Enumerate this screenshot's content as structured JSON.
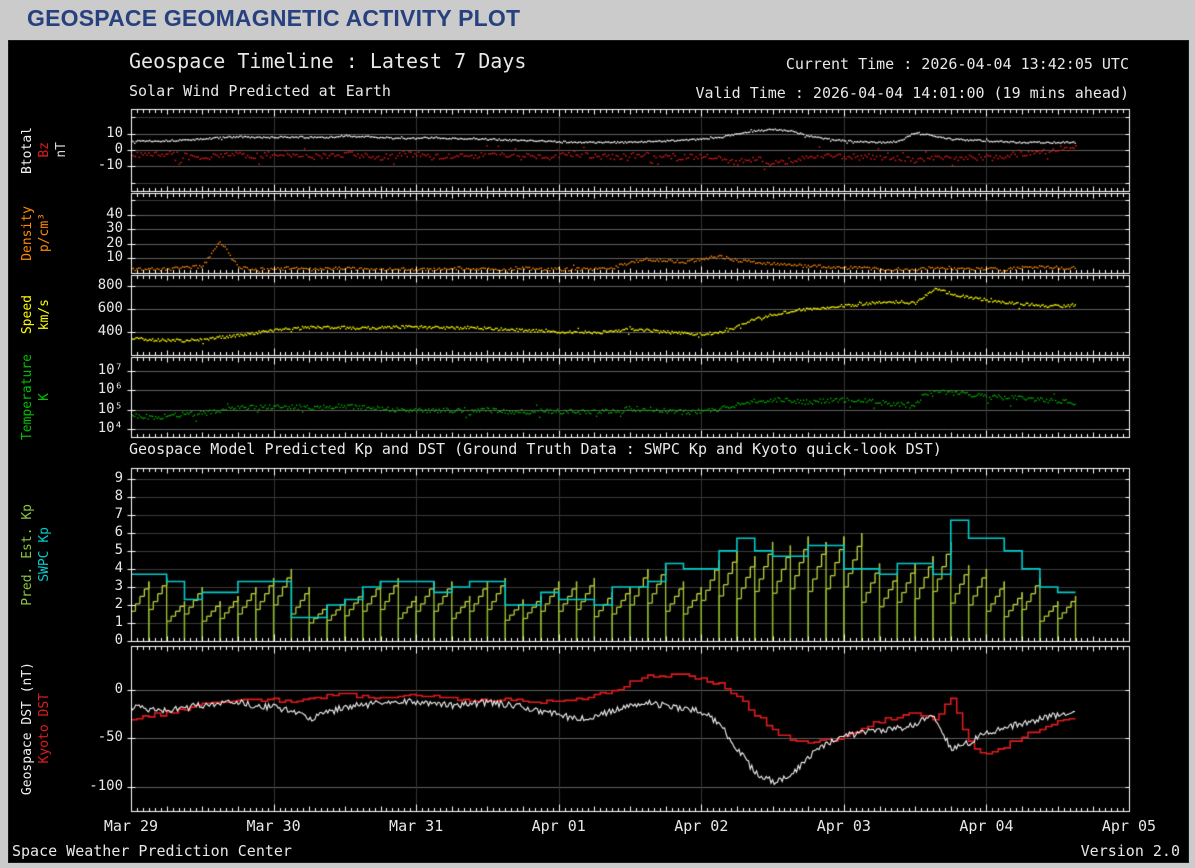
{
  "page_title": "GEOSPACE GEOMAGNETIC ACTIVITY PLOT",
  "header": {
    "title": "Geospace Timeline : Latest 7 Days",
    "subtitle": "Solar Wind Predicted at Earth",
    "current_time": "Current Time : 2026-04-04 13:42:05 UTC",
    "valid_time": "Valid Time : 2026-04-04 14:01:00 (19 mins ahead)"
  },
  "section2": {
    "title": "Geospace Model Predicted Kp and DST (Ground Truth Data : SWPC Kp and Kyoto quick-look DST)"
  },
  "footer": {
    "left": "Space Weather Prediction Center",
    "right": "Version 2.0"
  },
  "colors": {
    "page_bg": "#cbcbcb",
    "title_color": "#26417e",
    "frame_bg": "#000000",
    "text_color": "#e8e8e8",
    "axis": "#ffffff",
    "grid_major": "#5e5e5e",
    "grid_minor": "#3a3a3a",
    "day_line": "#343434",
    "btotal": "#f2f2f2",
    "bz": "#dd1c1c",
    "density": "#ff8c00",
    "speed": "#ffff00",
    "temperature": "#00c000",
    "pred_kp_low": "#6aa821",
    "pred_kp_high": "#e8e84a",
    "pred_kp_label": "#8cc63f",
    "swpc_kp": "#00cccc",
    "geospace_dst": "#f2f2f2",
    "kyoto_dst": "#dd1c1c"
  },
  "x_axis": {
    "labels": [
      "Mar 29",
      "Mar 30",
      "Mar 31",
      "Apr 01",
      "Apr 02",
      "Apr 03",
      "Apr 04",
      "Apr 05"
    ],
    "days_span": 7
  },
  "chart_data": {
    "type": "line",
    "description": "Six stacked time-series panels, Mar 29 00:00 UTC to Apr 05 00:00 UTC; data ends 2026-04-04 ~14:00 UTC",
    "t0_days": 0,
    "dt_days": 0.125,
    "panels": [
      {
        "id": "imf",
        "ylabel_lines": [
          {
            "text": "Btotal",
            "color": "#f2f2f2"
          },
          {
            "text": "Bz",
            "color": "#dd1c1c"
          },
          {
            "text": "nT",
            "color": "#d8d8d8"
          }
        ],
        "scale": "linear",
        "ylim": [
          -25,
          25
        ],
        "yticks": {
          "values": [
            10,
            0,
            -10
          ],
          "labels": [
            "10",
            "0",
            "-10"
          ]
        },
        "grid_major": [
          10,
          0,
          -10
        ],
        "grid_minor": [
          20,
          -20
        ],
        "series": [
          {
            "name": "Btotal",
            "render": "scatter",
            "color": "#f2f2f2",
            "noise": 0.5,
            "spacing": 1.5,
            "size": 1.4,
            "outlier_p": 0.03,
            "values": [
              6,
              6,
              6,
              6.5,
              7,
              8,
              8.5,
              8,
              8,
              8.5,
              8,
              8,
              9,
              8.5,
              8,
              7.5,
              7.5,
              8,
              7.5,
              7,
              7,
              6.5,
              6,
              6,
              5.5,
              5,
              5,
              5,
              5,
              5.5,
              6,
              6.5,
              7,
              8,
              10,
              12,
              13,
              12,
              9,
              7,
              6,
              5.5,
              5,
              5.5,
              11,
              9,
              7,
              6.5,
              6,
              5.5,
              5,
              5,
              5,
              5
            ]
          },
          {
            "name": "Bz",
            "render": "scatter",
            "color": "#dd1c1c",
            "noise": 1.8,
            "spacing": 1.9,
            "size": 1.5,
            "outlier_p": 0.08,
            "values": [
              -2,
              -3,
              -2,
              -3,
              -4,
              -3,
              -2,
              -3,
              -3,
              -2,
              -4,
              -3,
              -2,
              -3,
              -4,
              -3,
              -2,
              -3,
              -4,
              -3,
              -2,
              -2,
              -3,
              -3,
              -3,
              -2,
              -3,
              -4,
              -3,
              -2,
              -3,
              -4,
              -3,
              -5,
              -7,
              -5,
              -8,
              -6,
              -4,
              -3,
              -4,
              -3,
              -4,
              -5,
              -6,
              -4,
              -5,
              -4,
              -4,
              -3,
              -2,
              -1,
              1,
              2
            ]
          }
        ]
      },
      {
        "id": "density",
        "ylabel_lines": [
          {
            "text": "Density",
            "color": "#ff8c00"
          },
          {
            "text": "p/cm³",
            "color": "#ff8c00"
          }
        ],
        "scale": "linear",
        "ylim": [
          0,
          55
        ],
        "yticks": {
          "values": [
            40,
            30,
            20,
            10
          ],
          "labels": [
            "40",
            "30",
            "20",
            "10"
          ]
        },
        "grid_major": [
          40,
          30,
          20,
          10
        ],
        "grid_minor": [
          50
        ],
        "series": [
          {
            "name": "Density",
            "render": "scatter",
            "color": "#ff8c00",
            "noise": 1.1,
            "spacing": 1.7,
            "size": 1.4,
            "outlier_p": 0.02,
            "clamp_min": 0.3,
            "values": [
              3,
              3,
              3,
              4,
              5,
              22,
              4,
              3,
              3,
              4,
              3,
              3,
              4,
              3,
              3,
              3,
              3,
              3,
              4,
              3,
              3,
              3,
              4,
              3,
              3,
              3,
              3,
              4,
              8,
              10,
              9,
              8,
              10,
              12,
              9,
              8,
              7,
              6,
              5,
              5,
              4,
              4,
              3,
              3,
              3,
              4,
              3,
              3,
              3,
              3,
              4,
              5,
              4,
              4
            ]
          }
        ]
      },
      {
        "id": "speed",
        "ylabel_lines": [
          {
            "text": "Speed",
            "color": "#ffff00"
          },
          {
            "text": "km/s",
            "color": "#ffff00"
          }
        ],
        "scale": "linear",
        "ylim": [
          200,
          900
        ],
        "yticks": {
          "values": [
            800,
            600,
            400
          ],
          "labels": [
            "800",
            "600",
            "400"
          ]
        },
        "grid_major": [
          800,
          600,
          400
        ],
        "grid_minor": [],
        "series": [
          {
            "name": "Speed",
            "render": "scatter",
            "color": "#ffff00",
            "noise": 13,
            "spacing": 1.4,
            "size": 1.4,
            "outlier_p": 0.02,
            "values": [
              350,
              340,
              335,
              330,
              340,
              360,
              380,
              400,
              420,
              435,
              445,
              450,
              445,
              440,
              445,
              450,
              450,
              445,
              440,
              445,
              438,
              430,
              422,
              415,
              410,
              405,
              400,
              410,
              430,
              420,
              405,
              392,
              390,
              400,
              450,
              520,
              560,
              590,
              610,
              625,
              635,
              650,
              665,
              670,
              660,
              780,
              745,
              710,
              685,
              665,
              650,
              640,
              632,
              645
            ]
          }
        ]
      },
      {
        "id": "temperature",
        "ylabel_lines": [
          {
            "text": "Temperature",
            "color": "#00c000"
          },
          {
            "text": "K",
            "color": "#00c000"
          }
        ],
        "scale": "log",
        "ylim_log": [
          3.6,
          7.7
        ],
        "yticks": {
          "values": [
            7,
            6,
            5,
            4
          ],
          "labels": [
            "10⁷",
            "10⁶",
            "10⁵",
            "10⁴"
          ]
        },
        "grid_major": [
          7,
          6,
          5,
          4
        ],
        "grid_minor": [],
        "series": [
          {
            "name": "Temperature",
            "render": "scatter",
            "color": "#00c000",
            "noise": 0.13,
            "spacing": 1.5,
            "size": 1.3,
            "outlier_p": 0.04,
            "values": [
              50000,
              45000,
              50000,
              60000,
              70000,
              90000,
              130000,
              150000,
              160000,
              150000,
              140000,
              150000,
              160000,
              140000,
              120000,
              110000,
              100000,
              90000,
              100000,
              110000,
              100000,
              90000,
              85000,
              90000,
              90000,
              80000,
              85000,
              90000,
              120000,
              110000,
              90000,
              80000,
              90000,
              120000,
              200000,
              300000,
              350000,
              300000,
              250000,
              300000,
              350000,
              300000,
              250000,
              200000,
              180000,
              1000000,
              800000,
              600000,
              500000,
              450000,
              400000,
              350000,
              300000,
              250000
            ]
          }
        ]
      },
      {
        "id": "kp",
        "ylabel_lines": [
          {
            "text": "Pred. Est. Kp",
            "color": "#8cc63f"
          },
          {
            "text": "SWPC Kp",
            "color": "#00cccc"
          }
        ],
        "scale": "linear",
        "ylim": [
          0,
          9.6
        ],
        "yticks": {
          "values": [
            9,
            8,
            7,
            6,
            5,
            4,
            3,
            2,
            1,
            0
          ],
          "labels": [
            "9",
            "8",
            "7",
            "6",
            "5",
            "4",
            "3",
            "2",
            "1",
            "0"
          ]
        },
        "grid_major": [],
        "grid_minor": [
          1,
          2,
          3,
          4,
          5,
          6,
          7,
          8,
          9
        ],
        "series": [
          {
            "name": "Pred. Est. Kp",
            "render": "sawtooth",
            "color_low": "#6aa821",
            "color_high": "#e8e84a",
            "slot_days": 0.125,
            "peaks": [
              3.3,
              3.5,
              2.2,
              3.0,
              2.2,
              2.5,
              3.0,
              3.5,
              4.0,
              3.0,
              2.0,
              2.3,
              2.8,
              3.3,
              3.5,
              2.5,
              3.3,
              3.3,
              2.5,
              3.3,
              3.5,
              2.3,
              2.5,
              3.3,
              3.3,
              3.5,
              2.7,
              3.0,
              4.0,
              4.2,
              3.3,
              3.0,
              4.5,
              5.0,
              4.7,
              5.5,
              5.3,
              5.8,
              5.5,
              5.8,
              6.0,
              4.3,
              3.8,
              4.3,
              4.7,
              5.5,
              4.2,
              4.0,
              3.3,
              2.7,
              3.5,
              2.2,
              2.5
            ]
          },
          {
            "name": "SWPC Kp",
            "render": "steps",
            "color": "#00cccc",
            "slot_days": 0.125,
            "values": [
              3.7,
              3.7,
              3.3,
              2.3,
              2.7,
              2.7,
              3.3,
              3.3,
              3.3,
              1.3,
              1.3,
              2.0,
              2.3,
              3.0,
              3.3,
              3.3,
              3.3,
              2.7,
              3.0,
              3.3,
              3.3,
              2.0,
              2.0,
              2.7,
              2.3,
              2.3,
              2.0,
              3.0,
              3.0,
              3.3,
              4.3,
              4.0,
              4.0,
              5.0,
              5.7,
              5.0,
              4.7,
              4.7,
              5.3,
              5.3,
              4.0,
              4.0,
              3.7,
              4.3,
              4.3,
              3.7,
              6.7,
              5.7,
              5.7,
              5.0,
              4.0,
              3.0,
              2.7
            ]
          }
        ]
      },
      {
        "id": "dst",
        "ylabel_lines": [
          {
            "text": "Geospace DST (nT)",
            "color": "#f2f2f2"
          },
          {
            "text": "Kyoto DST",
            "color": "#dd1c1c"
          }
        ],
        "scale": "linear",
        "ylim": [
          -125,
          45
        ],
        "yticks": {
          "values": [
            0,
            -50,
            -100
          ],
          "labels": [
            "0",
            "-50",
            "-100"
          ]
        },
        "grid_major": [
          0,
          -50,
          -100
        ],
        "grid_minor": [],
        "series": [
          {
            "name": "Kyoto DST",
            "render": "hourly-steps",
            "color": "#dd1c1c",
            "noise": 2,
            "values": [
              -30,
              -27,
              -24,
              -20,
              -16,
              -13,
              -11,
              -10,
              -11,
              -13,
              -9,
              -7,
              -5,
              -7,
              -9,
              -7,
              -5,
              -7,
              -9,
              -11,
              -12,
              -10,
              -11,
              -12,
              -11,
              -9,
              -6,
              -2,
              8,
              14,
              15,
              14,
              12,
              5,
              -8,
              -25,
              -42,
              -52,
              -55,
              -52,
              -48,
              -40,
              -32,
              -28,
              -25,
              -30,
              -10,
              -55,
              -68,
              -58,
              -48,
              -40,
              -33,
              -28
            ]
          },
          {
            "name": "Geospace DST",
            "render": "noisyline",
            "color": "#f2f2f2",
            "noise": 3.5,
            "values": [
              -18,
              -20,
              -21,
              -19,
              -16,
              -14,
              -13,
              -16,
              -18,
              -22,
              -30,
              -24,
              -18,
              -16,
              -14,
              -13,
              -12,
              -14,
              -16,
              -15,
              -13,
              -15,
              -18,
              -22,
              -26,
              -30,
              -28,
              -22,
              -16,
              -14,
              -16,
              -20,
              -22,
              -35,
              -60,
              -85,
              -95,
              -90,
              -70,
              -55,
              -48,
              -44,
              -42,
              -40,
              -35,
              -25,
              -60,
              -55,
              -45,
              -40,
              -35,
              -30,
              -26,
              -22
            ]
          }
        ]
      }
    ]
  }
}
